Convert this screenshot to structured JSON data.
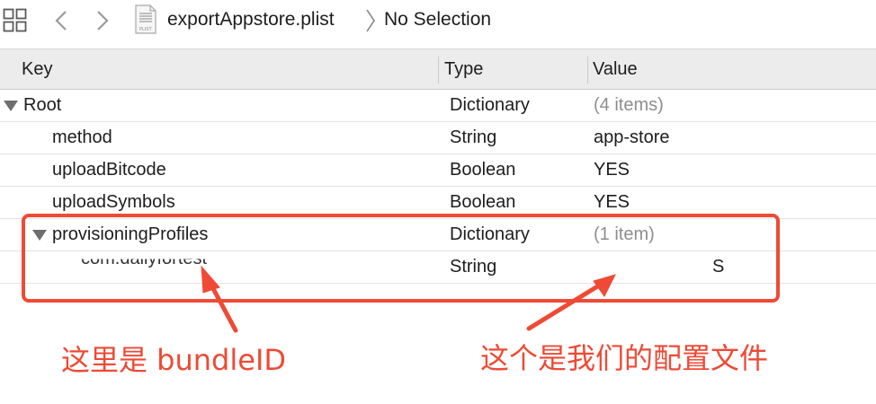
{
  "jumpbar": {
    "file_name": "exportAppstore.plist",
    "selection": "No Selection",
    "icons": [
      "grid-icon",
      "chevron-left-icon",
      "chevron-right-icon",
      "plist-file-icon",
      "breadcrumb-chevron-icon"
    ]
  },
  "table": {
    "headers": [
      "Key",
      "Type",
      "Value"
    ],
    "rows": [
      {
        "key": "Root",
        "type": "Dictionary",
        "value": "(4 items)",
        "expanded": true,
        "muted_value": true
      },
      {
        "key": "method",
        "type": "String",
        "value": "app-store"
      },
      {
        "key": "uploadBitcode",
        "type": "Boolean",
        "value": "YES"
      },
      {
        "key": "uploadSymbols",
        "type": "Boolean",
        "value": "YES"
      },
      {
        "key": "provisioningProfiles",
        "type": "Dictionary",
        "value": "(1 item)",
        "expanded": true,
        "muted_value": true
      },
      {
        "key": "com.dailyfortest",
        "type": "String",
        "value": "S",
        "redacted": true
      }
    ]
  },
  "annotations": {
    "bundle_id_label": "这里是 bundleID",
    "profile_label": "这个是我们的配置文件",
    "accent_color": "#ee4a35"
  }
}
